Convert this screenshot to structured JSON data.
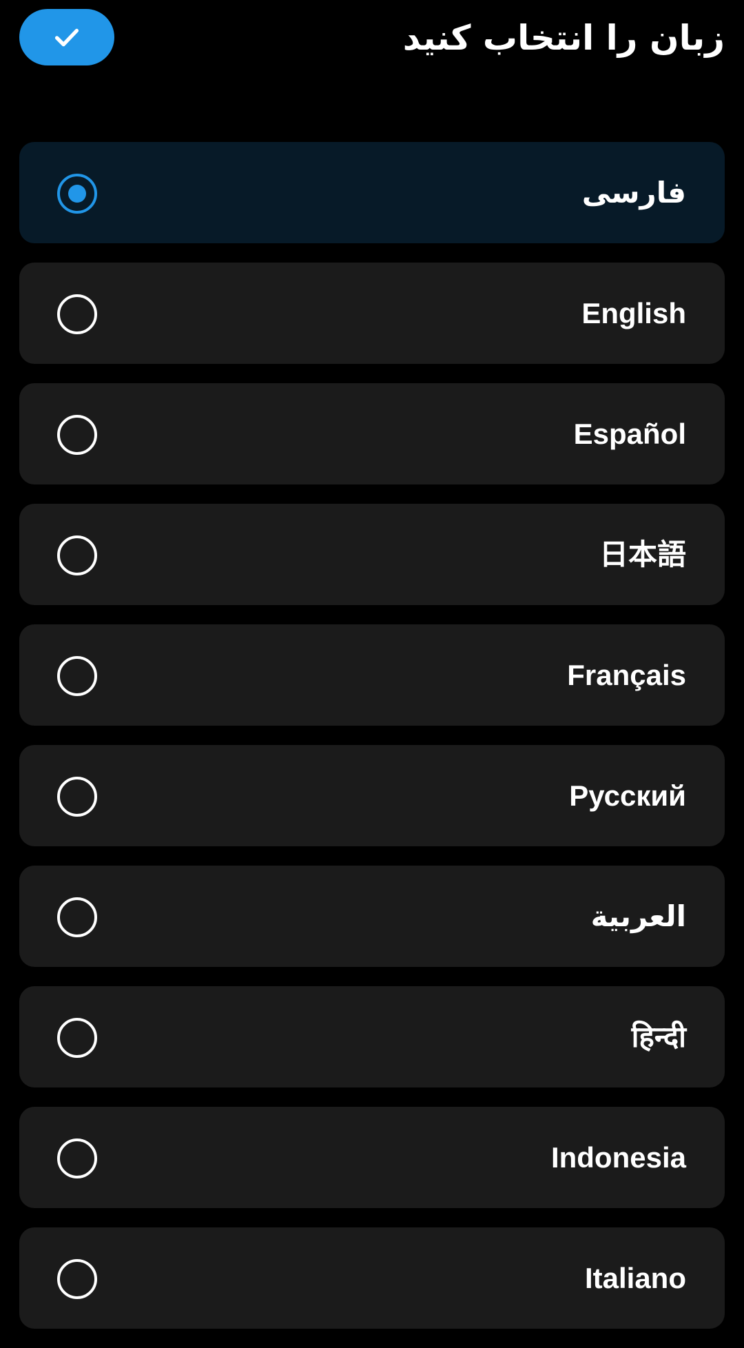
{
  "header": {
    "title": "زبان را انتخاب کنید",
    "confirm_icon": "check-icon",
    "confirm_color": "#2196e8"
  },
  "languages": [
    {
      "label": "فارسی",
      "selected": true
    },
    {
      "label": "English",
      "selected": false
    },
    {
      "label": "Español",
      "selected": false
    },
    {
      "label": "日本語",
      "selected": false
    },
    {
      "label": "Français",
      "selected": false
    },
    {
      "label": "Русский",
      "selected": false
    },
    {
      "label": "العربية",
      "selected": false
    },
    {
      "label": "हिन्दी",
      "selected": false
    },
    {
      "label": "Indonesia",
      "selected": false
    },
    {
      "label": "Italiano",
      "selected": false
    }
  ],
  "colors": {
    "background": "#000000",
    "item_background": "#1b1b1b",
    "selected_item_background": "#071a28",
    "accent": "#2196e8"
  }
}
